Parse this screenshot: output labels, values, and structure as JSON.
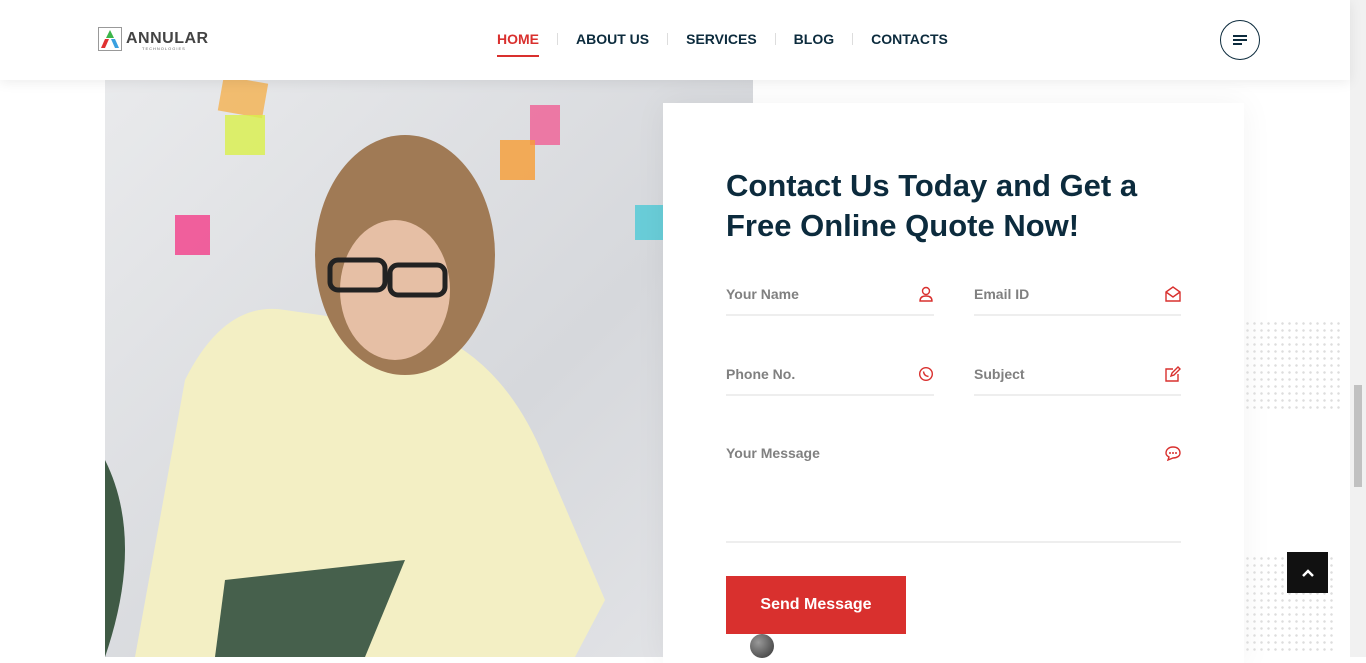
{
  "brand": {
    "name": "ANNULAR",
    "tagline": "TECHNOLOGIES"
  },
  "nav": {
    "items": [
      {
        "label": "HOME"
      },
      {
        "label": "ABOUT US"
      },
      {
        "label": "SERVICES"
      },
      {
        "label": "BLOG"
      },
      {
        "label": "CONTACTS"
      }
    ],
    "active": "HOME"
  },
  "contact": {
    "title": "Contact Us Today and Get a Free Online Quote Now!",
    "fields": {
      "name": "Your Name",
      "email": "Email ID",
      "phone": "Phone No.",
      "subject": "Subject",
      "message": "Your Message"
    },
    "submit": "Send Message"
  },
  "colors": {
    "accent": "#d9302e",
    "heading": "#0c2b3d"
  }
}
